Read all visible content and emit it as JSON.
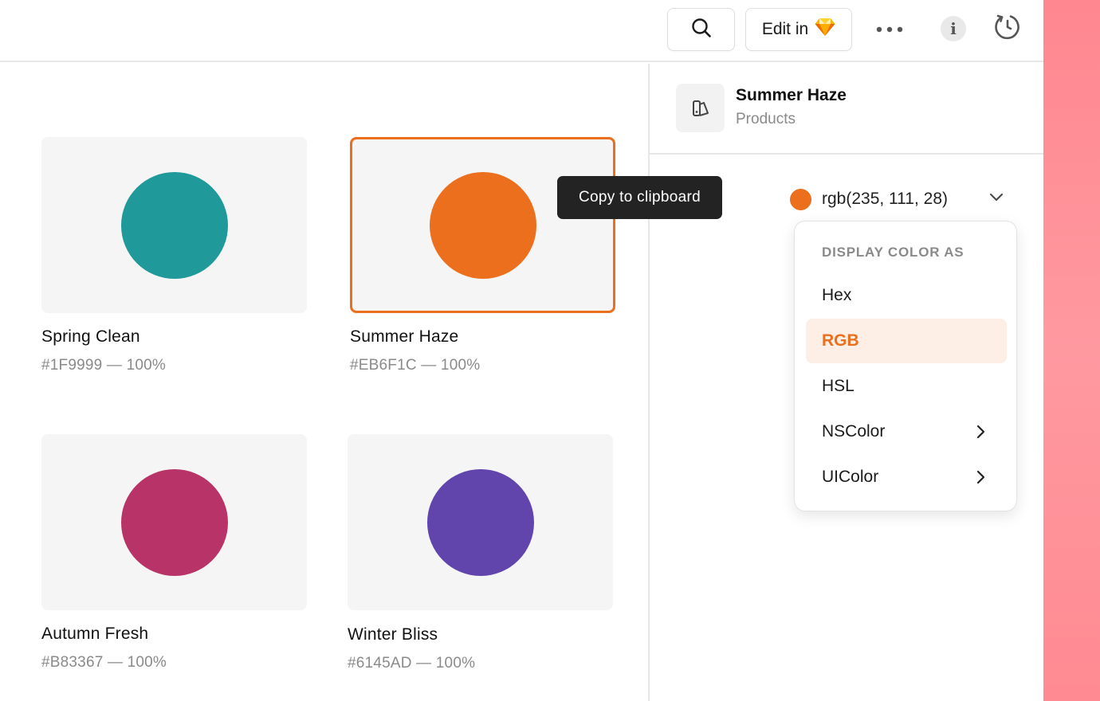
{
  "toolbar": {
    "edit_label": "Edit in",
    "edit_app_icon": "sketch-diamond-icon",
    "icons": [
      "search-icon",
      "more-icon",
      "info-icon",
      "history-icon"
    ],
    "info_glyph": "i"
  },
  "colors": {
    "accent": "#EB6F1C",
    "edge_gradient": "#FF8790"
  },
  "swatches": [
    {
      "name": "Spring Clean",
      "meta": "#1F9999 — 100%",
      "color": "#1F9999",
      "selected": false
    },
    {
      "name": "Summer Haze",
      "meta": "#EB6F1C — 100%",
      "color": "#EB6F1C",
      "selected": true
    },
    {
      "name": "Autumn Fresh",
      "meta": "#B83367 — 100%",
      "color": "#B83367",
      "selected": false
    },
    {
      "name": "Winter Bliss",
      "meta": "#6145AD — 100%",
      "color": "#6145AD",
      "selected": false
    }
  ],
  "tooltip": {
    "text": "Copy to clipboard"
  },
  "inspector": {
    "title": "Summer Haze",
    "subtitle": "Products",
    "icon": "color-palette-icon",
    "value": "rgb(235, 111, 28)",
    "value_color": "#EB6F1C"
  },
  "menu": {
    "header": "DISPLAY COLOR AS",
    "items": [
      {
        "label": "Hex",
        "active": false,
        "submenu": false
      },
      {
        "label": "RGB",
        "active": true,
        "submenu": false
      },
      {
        "label": "HSL",
        "active": false,
        "submenu": false
      },
      {
        "label": "NSColor",
        "active": false,
        "submenu": true
      },
      {
        "label": "UIColor",
        "active": false,
        "submenu": true
      }
    ]
  }
}
